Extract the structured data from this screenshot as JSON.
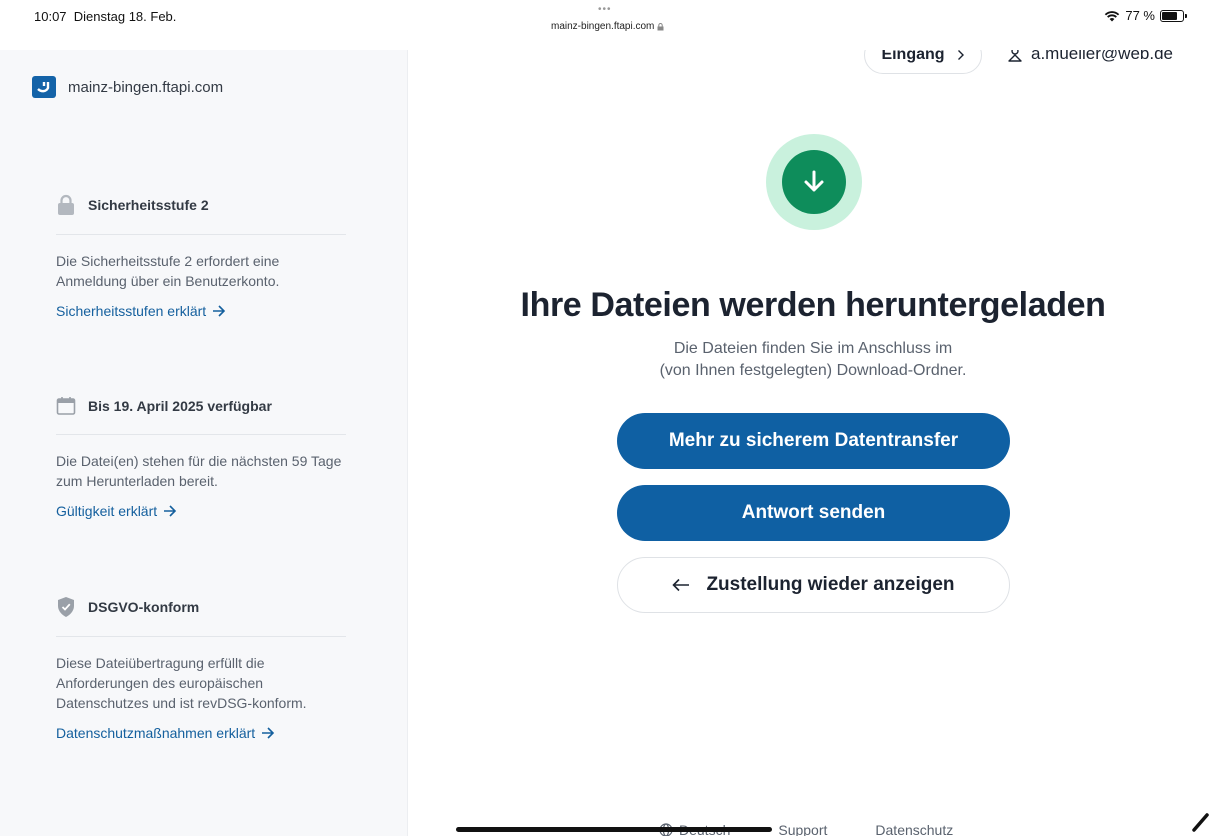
{
  "status_bar": {
    "time": "10:07",
    "date": "Dienstag 18. Feb.",
    "dots": "•••",
    "url": "mainz-bingen.ftapi.com",
    "battery": "77 %",
    "battery_level": 0.77
  },
  "sidebar": {
    "brand": "mainz-bingen.ftapi.com",
    "blocks": [
      {
        "title": "Sicherheitsstufe 2",
        "desc": "Die Sicherheitsstufe 2 erfordert eine Anmeldung über ein Benutzerkonto.",
        "link": "Sicherheitsstufen erklärt"
      },
      {
        "title": "Bis 19. April 2025 verfügbar",
        "desc": "Die Datei(en) stehen für die nächsten 59 Tage zum Herunterladen bereit.",
        "link": "Gültigkeit erklärt"
      },
      {
        "title": "DSGVO-konform",
        "desc": "Diese Dateiübertragung erfüllt die Anforderungen des europäischen Datenschutzes und ist revDSG-konform.",
        "link": "Datenschutzmaßnahmen erklärt"
      }
    ]
  },
  "header": {
    "inbox_label": "Eingang",
    "user_email": "a.mueller@web.de"
  },
  "main": {
    "headline": "Ihre Dateien werden heruntergeladen",
    "sub_line1": "Die Dateien finden Sie im Anschluss im",
    "sub_line2": "(von Ihnen festgelegten) Download-Ordner.",
    "btn_info": "Mehr zu sicherem Datentransfer",
    "btn_reply": "Antwort senden",
    "btn_back": "Zustellung wieder anzeigen"
  },
  "footer": {
    "language": "Deutsch",
    "support": "Support",
    "privacy": "Datenschutz"
  },
  "colors": {
    "primary": "#0f60a3",
    "link": "#15609e",
    "success": "#0e8d5b",
    "success_halo": "#c9f1dd"
  }
}
